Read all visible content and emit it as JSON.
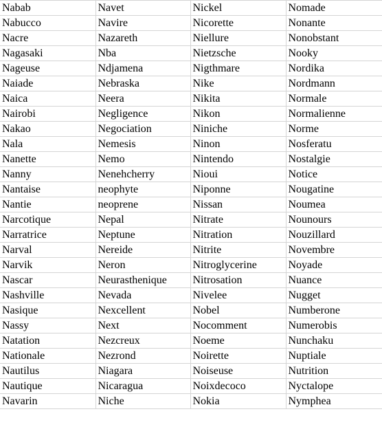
{
  "spreadsheet": {
    "columns": [
      [
        "Nabab",
        "Nabucco",
        "Nacre",
        "Nagasaki",
        "Nageuse",
        "Naiade",
        "Naica",
        "Nairobi",
        "Nakao",
        "Nala",
        "Nanette",
        "Nanny",
        "Nantaise",
        "Nantie",
        "Narcotique",
        "Narratrice",
        "Narval",
        "Narvik",
        "Nascar",
        "Nashville",
        "Nasique",
        "Nassy",
        "Natation",
        "Nationale",
        "Nautilus",
        "Nautique",
        "Navarin"
      ],
      [
        "Navet",
        "Navire",
        "Nazareth",
        "Nba",
        "Ndjamena",
        "Nebraska",
        "Neera",
        "Negligence",
        "Negociation",
        "Nemesis",
        "Nemo",
        "Nenehcherry",
        "neophyte",
        "neoprene",
        "Nepal",
        "Neptune",
        "Nereide",
        "Neron",
        "Neurasthenique",
        "Nevada",
        "Nexcellent",
        "Next",
        "Nezcreux",
        "Nezrond",
        "Niagara",
        "Nicaragua",
        "Niche"
      ],
      [
        "Nickel",
        "Nicorette",
        "Niellure",
        "Nietzsche",
        "Nigthmare",
        "Nike",
        "Nikita",
        "Nikon",
        "Niniche",
        "Ninon",
        "Nintendo",
        "Nioui",
        "Niponne",
        "Nissan",
        "Nitrate",
        "Nitration",
        "Nitrite",
        "Nitroglycerine",
        "Nitrosation",
        "Nivelee",
        "Nobel",
        "Nocomment",
        "Noeme",
        "Noirette",
        "Noiseuse",
        "Noixdecoco",
        "Nokia"
      ],
      [
        "Nomade",
        "Nonante",
        "Nonobstant",
        "Nooky",
        "Nordika",
        "Nordmann",
        "Normale",
        "Normalienne",
        "Norme",
        "Nosferatu",
        "Nostalgie",
        "Notice",
        "Nougatine",
        "Noumea",
        "Nounours",
        "Nouzillard",
        "Novembre",
        "Noyade",
        "Nuance",
        "Nugget",
        "Numberone",
        "Numerobis",
        "Nunchaku",
        "Nuptiale",
        "Nutrition",
        "Nyctalope",
        "Nymphea"
      ]
    ],
    "gridline_color": "#d4d4d4",
    "text_color": "#000000",
    "background": "#ffffff"
  }
}
